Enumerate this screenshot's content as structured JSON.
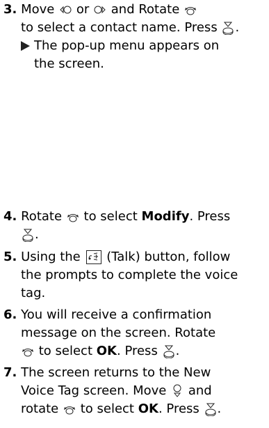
{
  "steps": {
    "s3": {
      "num": "3.",
      "t1": "Move",
      "t2": "or",
      "t3": "and Rotate",
      "t4": "to select a contact name. Press",
      "t5": ".",
      "result_l1": "The pop-up menu appears on",
      "result_l2": "the screen."
    },
    "s4": {
      "num": "4.",
      "t1": "Rotate",
      "t2": "to select",
      "b1": "Modify",
      "t3": ". Press",
      "t4": "."
    },
    "s5": {
      "num": "5.",
      "t1": "Using the",
      "t2": "(Talk) button, follow",
      "l2": "the prompts to complete the voice",
      "l3": "tag."
    },
    "s6": {
      "num": "6.",
      "t1": "You will receive a confirmation",
      "l2": "message on the screen. Rotate",
      "t2": "to select",
      "b1": "OK",
      "t3": ". Press",
      "t4": "."
    },
    "s7": {
      "num": "7.",
      "t1": "The screen returns to the New",
      "l2a": "Voice Tag screen. Move",
      "l2b": "and",
      "l3a": "rotate",
      "l3b": "to select",
      "b1": "OK",
      "l3c": ". Press",
      "l3d": "."
    }
  },
  "icons": {
    "move_left": "move-left-icon",
    "move_right": "move-right-icon",
    "move_down": "move-down-icon",
    "rotate": "rotate-icon",
    "press": "press-icon",
    "talk": "talk-button-icon",
    "result_arrow": "result-arrow-icon"
  }
}
